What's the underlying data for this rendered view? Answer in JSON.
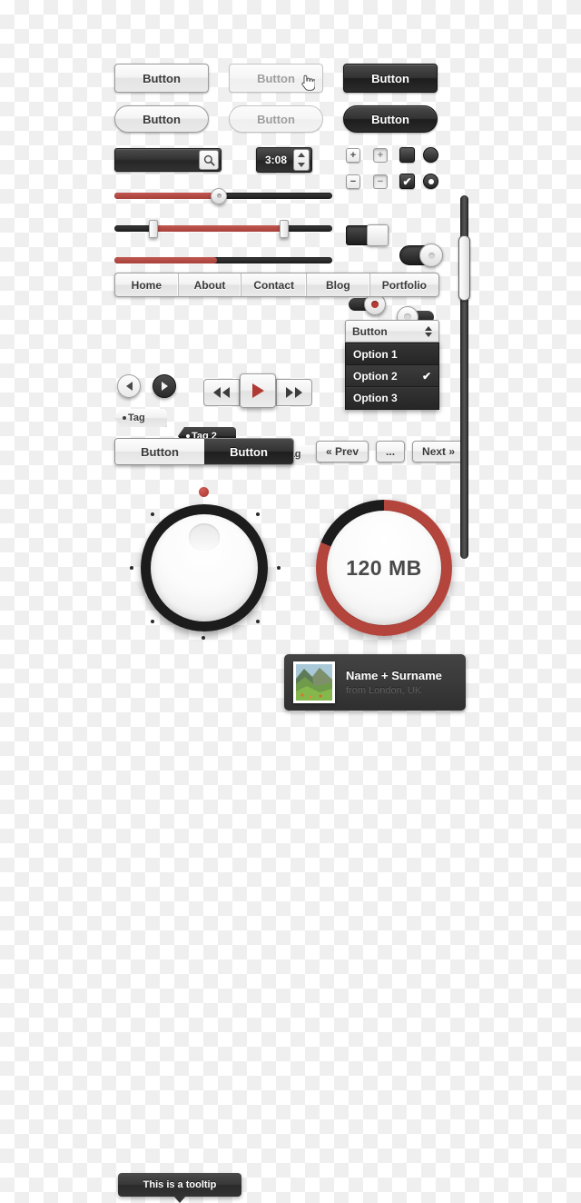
{
  "buttons": {
    "row1": [
      {
        "label": "Button",
        "style": "light"
      },
      {
        "label": "Button",
        "style": "ghost-hover"
      },
      {
        "label": "Button",
        "style": "dark"
      }
    ],
    "row2": [
      {
        "label": "Button",
        "style": "light-pill"
      },
      {
        "label": "Button",
        "style": "ghost-pill"
      },
      {
        "label": "Button",
        "style": "dark-pill"
      }
    ]
  },
  "search": {
    "value": "",
    "placeholder": "",
    "icon": "search-icon"
  },
  "time_stepper": {
    "value": "3:08",
    "up_icon": "triangle-up-icon",
    "down_icon": "triangle-down-icon"
  },
  "steppers": {
    "plus_label": "+",
    "minus_label": "−",
    "check_glyph": "✔"
  },
  "sliders": [
    {
      "name": "single-slider",
      "fill_percent": 48,
      "handle_percent": 48
    },
    {
      "name": "range-slider",
      "start_percent": 18,
      "end_percent": 78
    },
    {
      "name": "progress-slider",
      "fill_percent": 47
    }
  ],
  "toggles": [
    {
      "name": "square-toggle",
      "state": "on"
    },
    {
      "name": "round-toggle",
      "state": "on"
    },
    {
      "name": "mini-toggle-red",
      "state": "on"
    },
    {
      "name": "mini-toggle-grey",
      "state": "off"
    }
  ],
  "nav": {
    "items": [
      {
        "label": "Home"
      },
      {
        "label": "About"
      },
      {
        "label": "Contact"
      },
      {
        "label": "Blog"
      },
      {
        "label": "Portfolio"
      }
    ]
  },
  "tags": [
    {
      "label": "Tag",
      "style": "light"
    },
    {
      "label": "Tag 2",
      "style": "dark"
    },
    {
      "label": "Long tag",
      "style": "light"
    }
  ],
  "select": {
    "label": "Button",
    "options": [
      {
        "label": "Option 1",
        "selected": false
      },
      {
        "label": "Option 2",
        "selected": true
      },
      {
        "label": "Option 3",
        "selected": false
      }
    ]
  },
  "media": {
    "prev_circle_icon": "triangle-left-icon",
    "next_circle_icon": "triangle-right-icon",
    "rewind_icon": "rewind-icon",
    "play_icon": "play-icon",
    "forward_icon": "fast-forward-icon"
  },
  "segmented": {
    "left_label": "Button",
    "right_label": "Button",
    "active": "right"
  },
  "pagination": {
    "prev_label": "« Prev",
    "ellipsis_label": "...",
    "next_label": "Next »"
  },
  "scrollbar": {
    "thumb_top_percent": 11,
    "thumb_height_percent": 18
  },
  "dial": {
    "name": "volume-knob",
    "indicator_color": "#a8342d",
    "tick_count": 8
  },
  "progress_ring": {
    "label": "120 MB",
    "percent": 81,
    "fill_color": "#b4453d",
    "remainder_color": "#1c1c1c"
  },
  "tooltip": {
    "text": "This is a tooltip"
  },
  "profile_card": {
    "name": "Name + Surname",
    "subtitle": "from London, UK",
    "thumbnail": "landscape-photo"
  }
}
